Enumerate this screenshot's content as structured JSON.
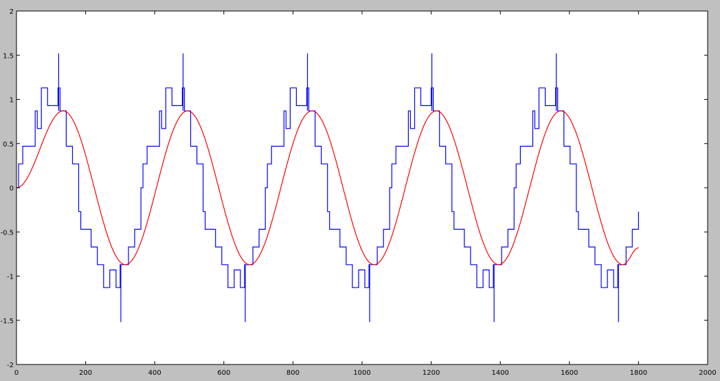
{
  "chart_data": {
    "type": "line",
    "title": "",
    "xlabel": "",
    "ylabel": "",
    "xlim": [
      0,
      2000
    ],
    "ylim": [
      -2,
      2
    ],
    "xticks": [
      "0",
      "200",
      "400",
      "600",
      "800",
      "1000",
      "1200",
      "1400",
      "1600",
      "1800",
      "2000"
    ],
    "yticks": [
      "-2",
      "-1.5",
      "-1",
      "-0.5",
      "0",
      "0.5",
      "1",
      "1.5",
      "2"
    ],
    "grid": false,
    "legend": "none",
    "series": [
      {
        "kind": "staircase",
        "color": "#0000ff",
        "period": 360,
        "x": [
          0,
          6,
          18,
          36,
          54,
          60,
          72,
          90,
          108,
          120,
          126,
          144,
          162,
          180,
          186,
          198,
          216,
          234,
          240,
          252,
          270,
          288,
          300,
          306,
          324,
          342,
          360
        ],
        "y": [
          0,
          0.27,
          0.47,
          0.47,
          0.87,
          0.67,
          1.13,
          0.93,
          0.93,
          1.13,
          0.87,
          0.47,
          0.27,
          -0.27,
          -0.47,
          -0.47,
          -0.67,
          -0.87,
          -0.87,
          -1.13,
          -0.93,
          -1.13,
          -0.87,
          -0.87,
          -0.67,
          -0.47,
          -0.27
        ],
        "spikes": [
          {
            "x": 122,
            "y1": 0.87,
            "y2": 1.52
          },
          {
            "x": 302,
            "y1": -0.87,
            "y2": -1.52
          }
        ]
      },
      {
        "kind": "smooth",
        "color": "#ff0000",
        "amplitude": 0.87,
        "peak_x": [
          135,
          495,
          855,
          1215,
          1575
        ],
        "trough_x": [
          315,
          675,
          1035,
          1395,
          1755
        ],
        "start": [
          0,
          0
        ],
        "end": [
          1800,
          -0.68
        ]
      }
    ]
  },
  "meta_colors": {
    "background": "#c0c0c0",
    "axes_face": "#ffffff"
  }
}
